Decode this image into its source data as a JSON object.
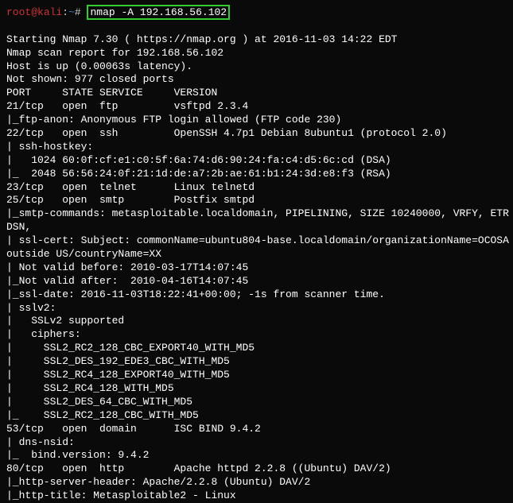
{
  "prompt": {
    "user": "root",
    "at": "@",
    "host": "kali",
    "sep": ":",
    "path": "~",
    "hash": "# ",
    "command": "nmap -A 192.168.56.102"
  },
  "lines": {
    "blank": " ",
    "l1": "Starting Nmap 7.30 ( https://nmap.org ) at 2016-11-03 14:22 EDT",
    "l2": "Nmap scan report for 192.168.56.102",
    "l3": "Host is up (0.00063s latency).",
    "l4": "Not shown: 977 closed ports",
    "l5": "PORT     STATE SERVICE     VERSION",
    "l6": "21/tcp   open  ftp         vsftpd 2.3.4",
    "l7": "|_ftp-anon: Anonymous FTP login allowed (FTP code 230)",
    "l8": "22/tcp   open  ssh         OpenSSH 4.7p1 Debian 8ubuntu1 (protocol 2.0)",
    "l9": "| ssh-hostkey:",
    "l10": "|   1024 60:0f:cf:e1:c0:5f:6a:74:d6:90:24:fa:c4:d5:6c:cd (DSA)",
    "l11": "|_  2048 56:56:24:0f:21:1d:de:a7:2b:ae:61:b1:24:3d:e8:f3 (RSA)",
    "l12": "23/tcp   open  telnet      Linux telnetd",
    "l13": "25/tcp   open  smtp        Postfix smtpd",
    "l14": "|_smtp-commands: metasploitable.localdomain, PIPELINING, SIZE 10240000, VRFY, ETR",
    "l15": "DSN,",
    "l16": "| ssl-cert: Subject: commonName=ubuntu804-base.localdomain/organizationName=OCOSA",
    "l17": "outside US/countryName=XX",
    "l18": "| Not valid before: 2010-03-17T14:07:45",
    "l19": "|_Not valid after:  2010-04-16T14:07:45",
    "l20": "|_ssl-date: 2016-11-03T18:22:41+00:00; -1s from scanner time.",
    "l21": "| sslv2:",
    "l22": "|   SSLv2 supported",
    "l23": "|   ciphers:",
    "l24": "|     SSL2_RC2_128_CBC_EXPORT40_WITH_MD5",
    "l25": "|     SSL2_DES_192_EDE3_CBC_WITH_MD5",
    "l26": "|     SSL2_RC4_128_EXPORT40_WITH_MD5",
    "l27": "|     SSL2_RC4_128_WITH_MD5",
    "l28": "|     SSL2_DES_64_CBC_WITH_MD5",
    "l29": "|_    SSL2_RC2_128_CBC_WITH_MD5",
    "l30": "53/tcp   open  domain      ISC BIND 9.4.2",
    "l31": "| dns-nsid:",
    "l32": "|_  bind.version: 9.4.2",
    "l33": "80/tcp   open  http        Apache httpd 2.2.8 ((Ubuntu) DAV/2)",
    "l34": "|_http-server-header: Apache/2.2.8 (Ubuntu) DAV/2",
    "l35": "|_http-title: Metasploitable2 - Linux"
  }
}
